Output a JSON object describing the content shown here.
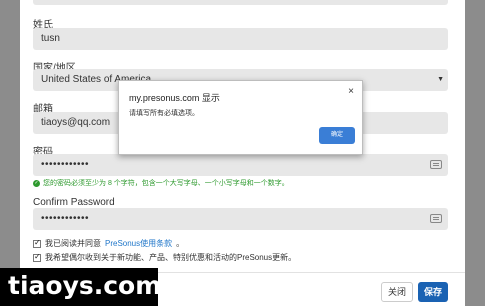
{
  "form": {
    "surname_label": "姓氏",
    "surname_value": "tusn",
    "country_label": "国家/地区",
    "country_value": "United States of America",
    "email_label": "邮箱",
    "email_value": "tiaoys@qq.com",
    "password_label": "密码",
    "password_value": "••••••••••••",
    "password_hint": "您的密码必须至少为 8 个字符，包含一个大写字母、一个小写字母和一个数字。",
    "confirm_label": "Confirm Password",
    "confirm_value": "••••••••••••",
    "terms_prefix": "我已阅读并同意",
    "terms_link": "PreSonus使用条款",
    "terms_suffix": "。",
    "newsletter_label": "我希望偶尔收到关于新功能、产品、特别优惠和活动的PreSonus更新。"
  },
  "footer": {
    "close_label": "关闭",
    "save_label": "保存"
  },
  "dialog": {
    "title": "my.presonus.com 显示",
    "message": "请填写所有必填选项。",
    "ok_label": "确定",
    "close_glyph": "×"
  },
  "watermark": "tiaoys.com",
  "colors": {
    "accent": "#1a62b3",
    "hint_green": "#2e9a2e",
    "field_bg": "#e7e7e7",
    "overlay": "#8c8c8c"
  }
}
